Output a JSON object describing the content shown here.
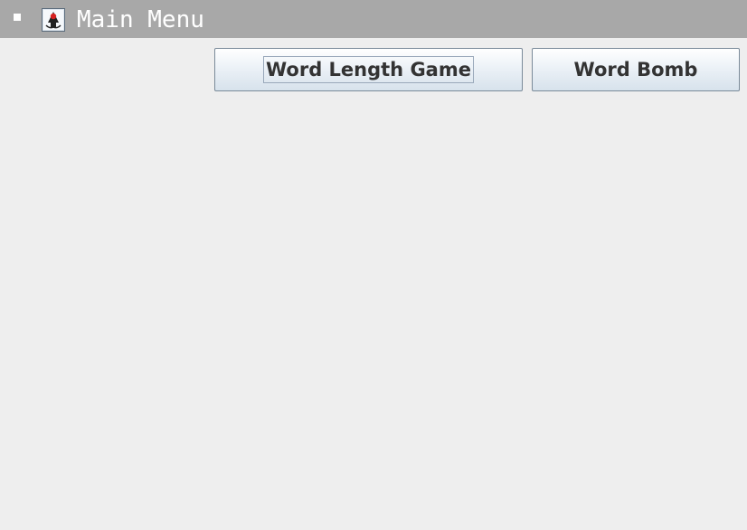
{
  "window": {
    "title": "Main Menu",
    "icons": {
      "system_menu": "system-menu-icon",
      "app": "java-duke-icon"
    }
  },
  "menu": {
    "buttons": [
      {
        "label": "Word Length Game",
        "focused": true
      },
      {
        "label": "Word Bomb",
        "focused": false
      }
    ]
  },
  "colors": {
    "titlebar": "#a8a8a8",
    "background": "#eeeeee",
    "button_text": "#333333",
    "button_border": "#7a8a99"
  }
}
